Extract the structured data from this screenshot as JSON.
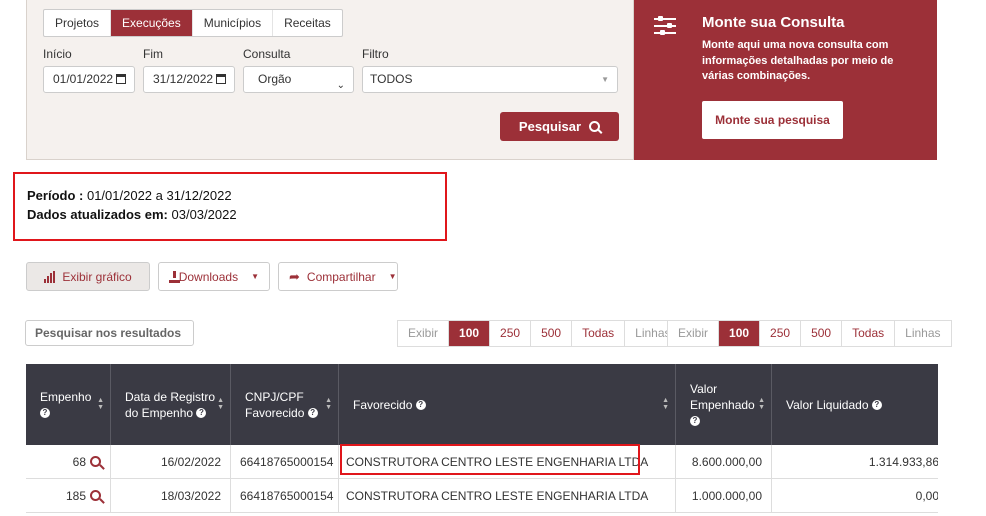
{
  "tabs": [
    "Projetos",
    "Execuções",
    "Municípios",
    "Receitas"
  ],
  "active_tab": "Execuções",
  "filters": {
    "inicio_label": "Início",
    "inicio_value": "01/01/2022",
    "fim_label": "Fim",
    "fim_value": "31/12/2022",
    "consulta_label": "Consulta",
    "consulta_value": "Orgão",
    "filtro_label": "Filtro",
    "filtro_value": "TODOS",
    "search_button": "Pesquisar"
  },
  "consulta_panel": {
    "title": "Monte sua Consulta",
    "description": "Monte aqui uma nova consulta com informações detalhadas por meio de várias combinações.",
    "button": "Monte sua pesquisa"
  },
  "period": {
    "periodo_label": "Período :",
    "periodo_value": "01/01/2022 a 31/12/2022",
    "atualizados_label": "Dados atualizados em:",
    "atualizados_value": "03/03/2022"
  },
  "toolbar": {
    "grafico": "Exibir gráfico",
    "downloads": "Downloads",
    "compartilhar": "Compartilhar"
  },
  "search_results_placeholder": "Pesquisar nos resultados",
  "pager_left": [
    "Exibir",
    "100",
    "250",
    "500",
    "Todas",
    "Linhas"
  ],
  "pager_right": [
    "Exibir",
    "100",
    "250",
    "500",
    "Todas",
    "Linhas"
  ],
  "table": {
    "headers": {
      "empenho": "Empenho",
      "data_registro_1": "Data de Registro",
      "data_registro_2": "do Empenho",
      "cnpj_1": "CNPJ/CPF",
      "cnpj_2": "Favorecido",
      "favorecido": "Favorecido",
      "valor_1": "Valor",
      "valor_2": "Empenhado",
      "valor_liquidado": "Valor Liquidado"
    },
    "rows": [
      {
        "empenho": "68",
        "data": "16/02/2022",
        "cnpj": "66418765000154",
        "favorecido": "CONSTRUTORA CENTRO LESTE ENGENHARIA LTDA",
        "valor_empenhado": "8.600.000,00",
        "valor_liquidado": "1.314.933,86"
      },
      {
        "empenho": "185",
        "data": "18/03/2022",
        "cnpj": "66418765000154",
        "favorecido": "CONSTRUTORA CENTRO LESTE ENGENHARIA LTDA",
        "valor_empenhado": "1.000.000,00",
        "valor_liquidado": "0,00"
      }
    ]
  },
  "colors": {
    "brand": "#9c3038",
    "header_bg": "#3a3a44",
    "highlight": "#e0161b"
  }
}
